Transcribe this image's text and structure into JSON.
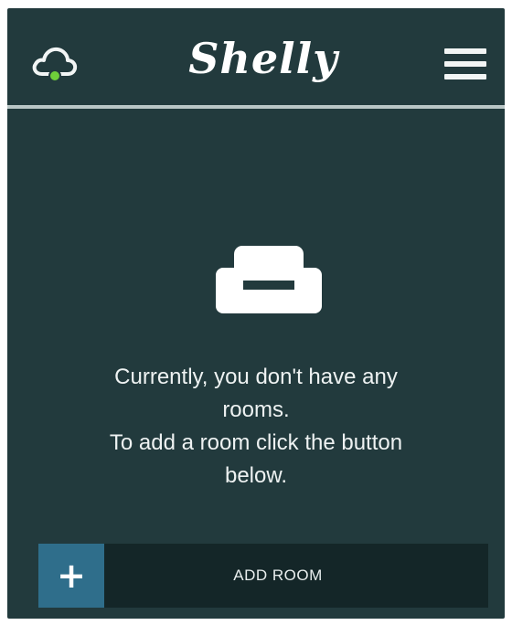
{
  "header": {
    "logo_text": "Shelly",
    "cloud_icon": "cloud-icon",
    "menu_icon": "hamburger-menu-icon"
  },
  "empty_state": {
    "icon": "sofa-icon",
    "line1": "Currently, you don't have any",
    "line2": "rooms.",
    "line3": "To add a room click the button",
    "line4": "below."
  },
  "add_room": {
    "plus": "+",
    "label": "ADD ROOM"
  },
  "colors": {
    "background": "#223a3d",
    "divider": "#b9c6c6",
    "button_bg": "#142628",
    "plus_bg": "#2f6e8b",
    "cloud_dot": "#6fcf3a"
  }
}
